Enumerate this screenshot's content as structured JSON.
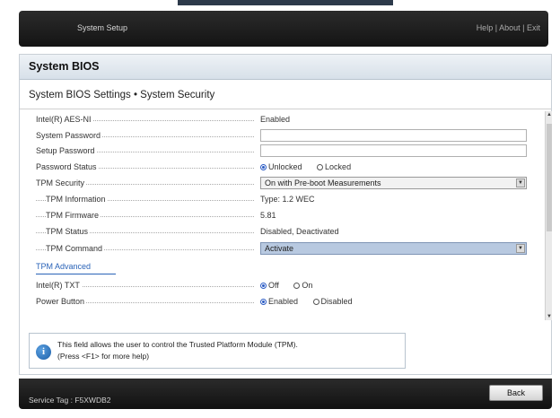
{
  "header": {
    "title": "System Setup",
    "help": "Help",
    "about": "About",
    "exit": "Exit",
    "sep": "|"
  },
  "panel": {
    "title": "System BIOS",
    "subtitle": "System BIOS Settings • System Security"
  },
  "settings": {
    "aes_label": "Intel(R) AES-NI",
    "aes_value": "Enabled",
    "sys_pwd_label": "System Password",
    "sys_pwd_value": "",
    "setup_pwd_label": "Setup Password",
    "setup_pwd_value": "",
    "pwd_status_label": "Password Status",
    "pwd_status_opt1": "Unlocked",
    "pwd_status_opt2": "Locked",
    "tpm_sec_label": "TPM Security",
    "tpm_sec_value": "On with Pre-boot Measurements",
    "tpm_info_label": "TPM Information",
    "tpm_info_value": "Type: 1.2  WEC",
    "tpm_fw_label": "TPM Firmware",
    "tpm_fw_value": "5.81",
    "tpm_status_label": "TPM Status",
    "tpm_status_value": "Disabled, Deactivated",
    "tpm_cmd_label": "TPM Command",
    "tpm_cmd_value": "Activate",
    "tpm_adv_link": "TPM Advanced",
    "txt_label": "Intel(R) TXT",
    "txt_opt1": "Off",
    "txt_opt2": "On",
    "power_label": "Power Button",
    "power_opt1": "Enabled",
    "power_opt2": "Disabled"
  },
  "help": {
    "line1": "This field allows the user to control the Trusted Platform Module (TPM).",
    "line2": "(Press <F1> for more help)"
  },
  "footer": {
    "service_tag": "Service Tag : F5XWDB2",
    "back": "Back"
  },
  "icons": {
    "info": "info-icon",
    "dropdown": "chevron-down-icon",
    "scroll_up": "scroll-up-arrow-icon",
    "scroll_down": "scroll-down-arrow-icon"
  },
  "colors": {
    "accent": "#2a5bc4",
    "link": "#2a63b8",
    "header_bg": "#1e1e1e",
    "active_select": "#b8c9e0"
  }
}
